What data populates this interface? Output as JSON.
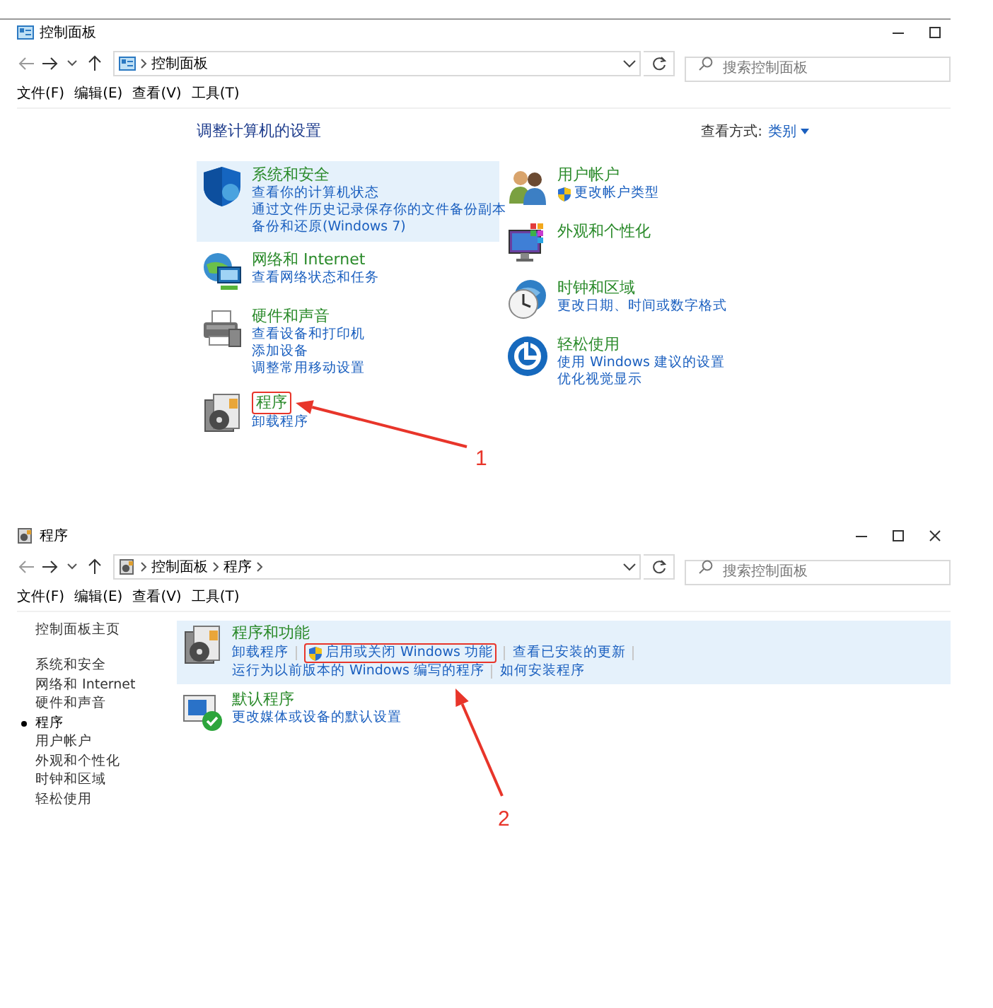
{
  "windows": [
    {
      "title": "控制面板",
      "title_buttons": [
        {
          "kind": "minimize"
        },
        {
          "kind": "maximize"
        }
      ],
      "address": {
        "crumbs": [
          "控制面板"
        ]
      },
      "search": {
        "placeholder": "搜索控制面板"
      },
      "menu": [
        "文件(F)",
        "编辑(E)",
        "查看(V)",
        "工具(T)"
      ],
      "heading": "调整计算机的设置",
      "view_by": {
        "label": "查看方式:",
        "value": "类别"
      },
      "columns": [
        [
          {
            "title": "系统和安全",
            "highlighted": true,
            "annotated": false,
            "links": [
              {
                "text": "查看你的计算机状态",
                "kind": "plain"
              },
              {
                "text": "通过文件历史记录保存你的文件备份副本",
                "kind": "plain"
              },
              {
                "text": "备份和还原(Windows 7)",
                "kind": "plain"
              }
            ]
          },
          {
            "title": "网络和 Internet",
            "highlighted": false,
            "annotated": false,
            "links": [
              {
                "text": "查看网络状态和任务",
                "kind": "plain"
              }
            ]
          },
          {
            "title": "硬件和声音",
            "highlighted": false,
            "annotated": false,
            "links": [
              {
                "text": "查看设备和打印机",
                "kind": "plain"
              },
              {
                "text": "添加设备",
                "kind": "plain"
              },
              {
                "text": "调整常用移动设置",
                "kind": "plain"
              }
            ]
          },
          {
            "title": "程序",
            "highlighted": false,
            "annotated": true,
            "links": [
              {
                "text": "卸载程序",
                "kind": "plain"
              }
            ]
          }
        ],
        [
          {
            "title": "用户帐户",
            "highlighted": false,
            "annotated": false,
            "links": [
              {
                "text": "更改帐户类型",
                "kind": "admin"
              }
            ]
          },
          {
            "title": "外观和个性化",
            "highlighted": false,
            "annotated": false
          },
          {
            "title": "时钟和区域",
            "highlighted": false,
            "annotated": false,
            "links": [
              {
                "text": "更改日期、时间或数字格式",
                "kind": "plain"
              }
            ]
          },
          {
            "title": "轻松使用",
            "highlighted": false,
            "annotated": false,
            "links": [
              {
                "text": "使用 Windows 建议的设置",
                "kind": "plain"
              },
              {
                "text": "优化视觉显示",
                "kind": "plain"
              }
            ]
          }
        ]
      ]
    },
    {
      "title": "程序",
      "title_buttons": [
        {
          "kind": "minimize"
        },
        {
          "kind": "maximize"
        },
        {
          "kind": "close"
        }
      ],
      "address": {
        "crumbs": [
          "控制面板",
          "程序"
        ]
      },
      "search": {
        "placeholder": "搜索控制面板"
      },
      "menu": [
        "文件(F)",
        "编辑(E)",
        "查看(V)",
        "工具(T)"
      ],
      "sidebar": {
        "home": "控制面板主页",
        "items": [
          {
            "label": "系统和安全",
            "selected": false
          },
          {
            "label": "网络和 Internet",
            "selected": false
          },
          {
            "label": "硬件和声音",
            "selected": false
          },
          {
            "label": "程序",
            "selected": true
          },
          {
            "label": "用户帐户",
            "selected": false
          },
          {
            "label": "外观和个性化",
            "selected": false
          },
          {
            "label": "时钟和区域",
            "selected": false
          },
          {
            "label": "轻松使用",
            "selected": false
          }
        ]
      },
      "sections": [
        {
          "title": "程序和功能",
          "highlighted": true,
          "link_rows": [
            [
              {
                "text": "卸载程序",
                "kind": "plain",
                "annotated": false
              },
              {
                "text": "启用或关闭 Windows 功能",
                "kind": "admin",
                "annotated": true
              },
              {
                "text": "查看已安装的更新",
                "kind": "plain",
                "annotated": false
              }
            ],
            [
              {
                "text": "运行为以前版本的 Windows 编写的程序",
                "kind": "plain",
                "annotated": false
              },
              {
                "text": "如何安装程序",
                "kind": "plain",
                "annotated": false
              }
            ]
          ]
        },
        {
          "title": "默认程序",
          "highlighted": false,
          "link_rows": [
            [
              {
                "text": "更改媒体或设备的默认设置",
                "kind": "plain",
                "annotated": false
              }
            ]
          ]
        }
      ]
    }
  ],
  "annotations": [
    {
      "label": "1"
    },
    {
      "label": "2"
    }
  ]
}
